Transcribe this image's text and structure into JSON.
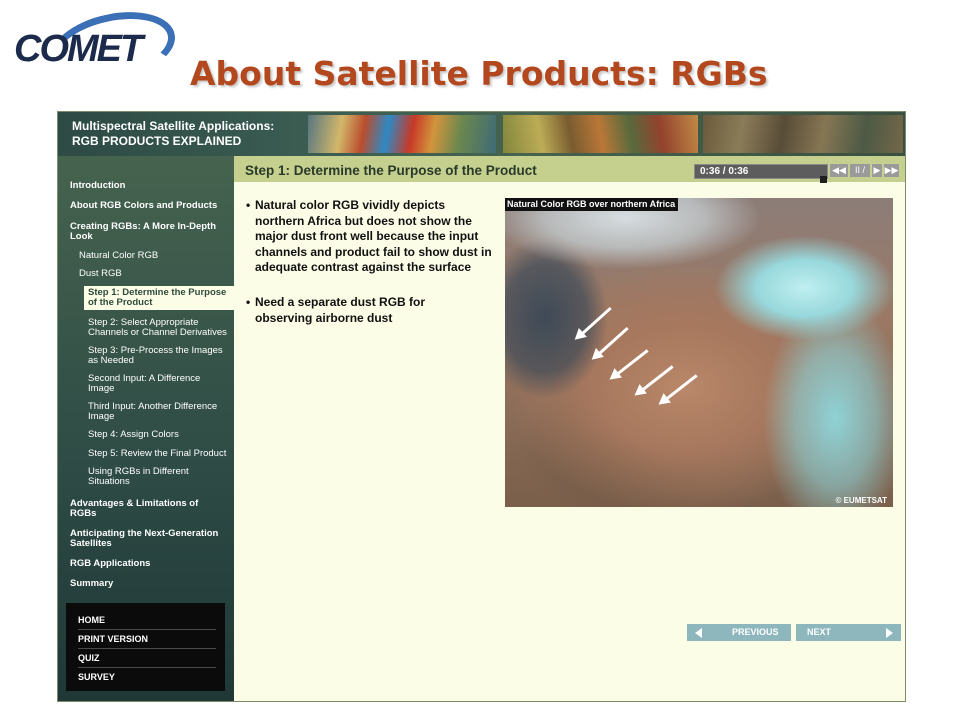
{
  "slide": {
    "logo_text": "COMET",
    "title": "About Satellite Products: RGBs"
  },
  "banner": {
    "line1": "Multispectral Satellite Applications:",
    "line2": "RGB PRODUCTS EXPLAINED"
  },
  "sidebar": {
    "items": [
      {
        "label": "Introduction"
      },
      {
        "label": "About RGB Colors and Products"
      },
      {
        "label": "Creating RGBs: A More In-Depth Look"
      },
      {
        "label": "Natural Color RGB"
      },
      {
        "label": "Dust RGB"
      },
      {
        "label": "Step 1: Determine the Purpose of the Product"
      },
      {
        "label": "Step 2: Select Appropriate Channels or Channel Derivatives"
      },
      {
        "label": "Step 3: Pre-Process the Images as Needed"
      },
      {
        "label": "Second Input: A Difference Image"
      },
      {
        "label": "Third Input: Another Difference Image"
      },
      {
        "label": "Step 4: Assign Colors"
      },
      {
        "label": "Step 5: Review the Final Product"
      },
      {
        "label": "Using RGBs in Different Situations"
      },
      {
        "label": "Advantages & Limitations of RGBs"
      },
      {
        "label": "Anticipating the Next-Generation Satellites"
      },
      {
        "label": "RGB Applications"
      },
      {
        "label": "Summary"
      }
    ],
    "bottom_menu": [
      "HOME",
      "PRINT VERSION",
      "QUIZ",
      "SURVEY"
    ]
  },
  "content": {
    "step_title": "Step 1: Determine the Purpose of the Product",
    "player": {
      "time": "0:36 / 0:36",
      "rewind_icon": "rewind-icon",
      "pause_icon": "pause-icon",
      "play_icon": "play-icon",
      "forward_icon": "forward-icon"
    },
    "bullets": [
      "Natural color RGB vividly depicts northern Africa but does not show the major dust front well because the input channels and product fail to show dust in adequate contrast against the surface",
      "Need a separate dust RGB for observing airborne dust"
    ],
    "figure": {
      "caption": "Natural Color RGB over northern Africa",
      "credit": "© EUMETSAT"
    },
    "buttons": {
      "previous": "PREVIOUS",
      "next": "NEXT"
    }
  },
  "colors": {
    "title": "#b3471d",
    "header_bar": "#c5d08f",
    "sidebar": "#2f4c46",
    "content_bg": "#fbfde6",
    "nav_button": "#8db7bd"
  }
}
